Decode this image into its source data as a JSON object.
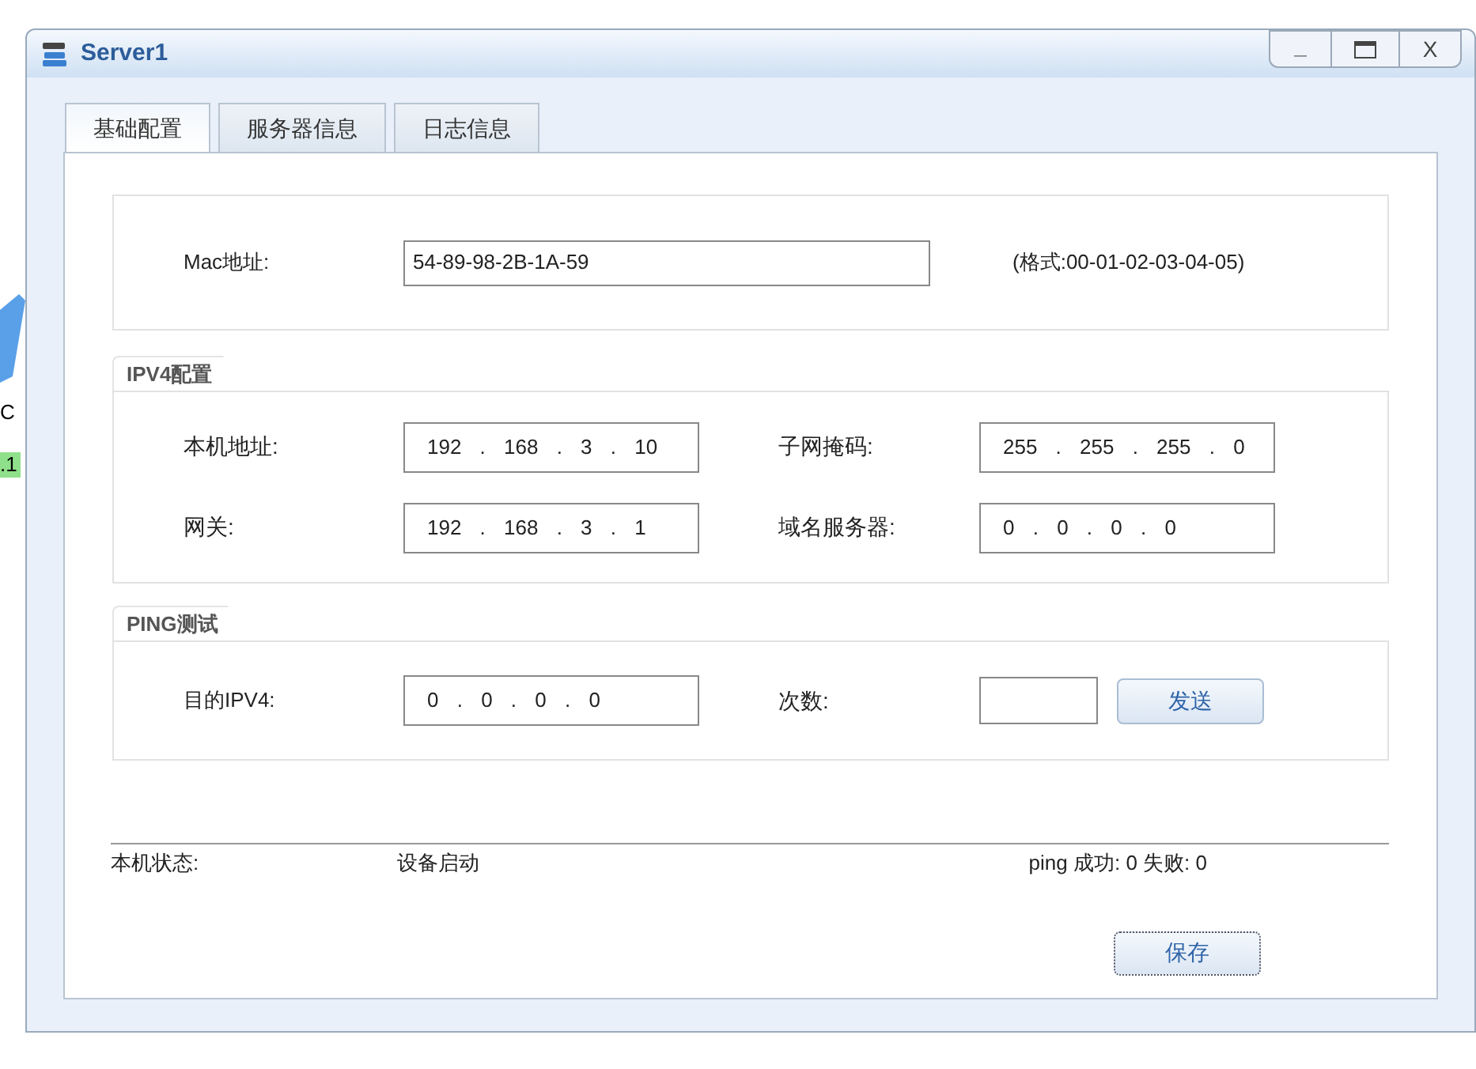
{
  "background": {
    "labels": [
      {
        "text": "C",
        "kind": "plain"
      },
      {
        "text": ".1",
        "kind": "tag"
      }
    ]
  },
  "window": {
    "title": "Server1",
    "controls": [
      "_",
      "X"
    ]
  },
  "tabs": [
    {
      "label": "基础配置",
      "selected": true
    },
    {
      "label": "服务器信息",
      "selected": false
    },
    {
      "label": "日志信息",
      "selected": false
    }
  ],
  "mac": {
    "label": "Mac地址:",
    "value": "54-89-98-2B-1A-59",
    "hint": "(格式:00-01-02-03-04-05)"
  },
  "ipv4": {
    "title": "IPV4配置",
    "fields": [
      {
        "label": "本机地址:",
        "value": "192 . 168 . 3 . 10"
      },
      {
        "label": "子网掩码:",
        "value": "255 . 255 . 255 . 0"
      },
      {
        "label": "网关:",
        "value": "192 . 168 . 3 . 1"
      },
      {
        "label": "域名服务器:",
        "value": "0 . 0 . 0 . 0"
      }
    ]
  },
  "ping": {
    "title": "PING测试",
    "target_label": "目的IPV4:",
    "target_value": "0 . 0 . 0 . 0",
    "count_label": "次数:",
    "send_button": "发送"
  },
  "status": {
    "label": "本机状态:",
    "value": "设备启动",
    "result": "ping 成功: 0 失败: 0"
  },
  "save_button": "保存"
}
